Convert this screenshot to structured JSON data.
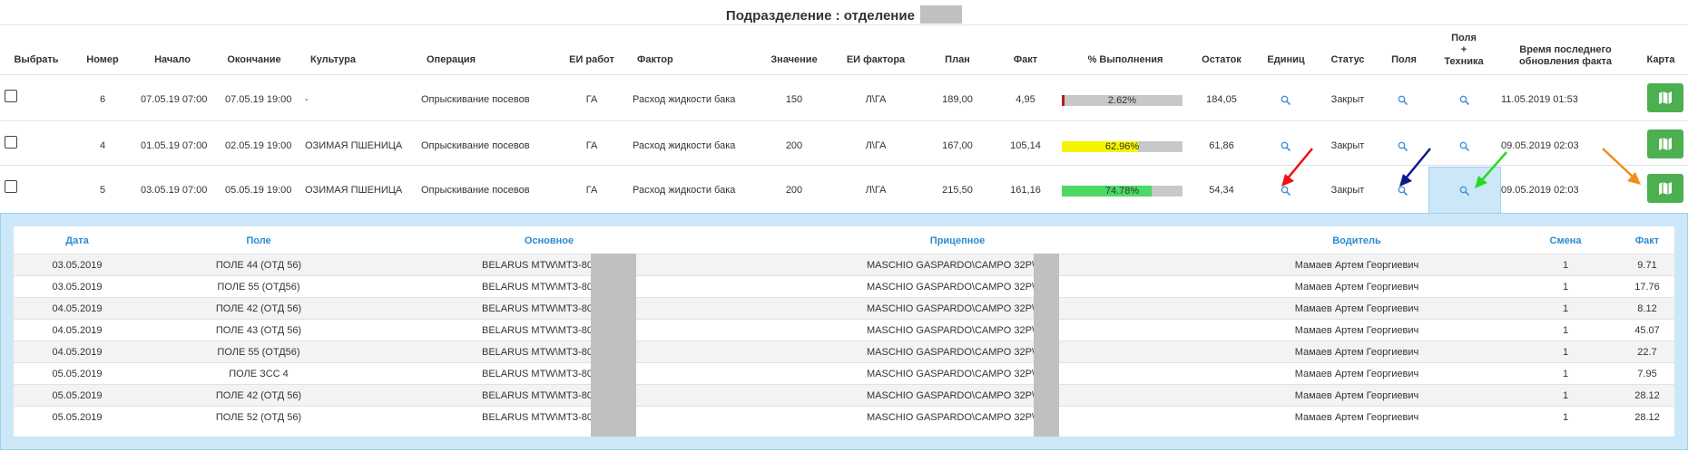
{
  "title": "Подразделение : отделение",
  "columns": {
    "select": "Выбрать",
    "number": "Номер",
    "start": "Начало",
    "end": "Окончание",
    "culture": "Культура",
    "operation": "Операция",
    "work_unit": "ЕИ работ",
    "factor": "Фактор",
    "value": "Значение",
    "factor_unit": "ЕИ фактора",
    "plan": "План",
    "fact": "Факт",
    "percent": "% Выполнения",
    "remain": "Остаток",
    "units": "Единиц",
    "status": "Статус",
    "fields": "Поля",
    "fields_tech_1": "Поля",
    "fields_tech_2": "+",
    "fields_tech_3": "Техника",
    "last_update_1": "Время последнего",
    "last_update_2": "обновления факта",
    "map": "Карта"
  },
  "rows": [
    {
      "number": "6",
      "start": "07.05.19 07:00",
      "end": "07.05.19 19:00",
      "culture": "-",
      "operation": "Опрыскивание посевов",
      "work_unit": "ГА",
      "factor": "Расход жидкости бака",
      "value": "150",
      "factor_unit": "Л\\ГА",
      "plan": "189,00",
      "fact": "4,95",
      "percent_label": "2.62%",
      "percent": 2.62,
      "bar_color": "#b71c1c",
      "remain": "184,05",
      "status": "Закрыт",
      "last_update": "11.05.2019 01:53"
    },
    {
      "number": "4",
      "start": "01.05.19 07:00",
      "end": "02.05.19 19:00",
      "culture": "ОЗИМАЯ ПШЕНИЦА",
      "operation": "Опрыскивание посевов",
      "work_unit": "ГА",
      "factor": "Расход жидкости бака",
      "value": "200",
      "factor_unit": "Л\\ГА",
      "plan": "167,00",
      "fact": "105,14",
      "percent_label": "62.96%",
      "percent": 62.96,
      "bar_color": "#f5f500",
      "remain": "61,86",
      "status": "Закрыт",
      "last_update": "09.05.2019 02:03"
    },
    {
      "number": "5",
      "start": "03.05.19 07:00",
      "end": "05.05.19 19:00",
      "culture": "ОЗИМАЯ ПШЕНИЦА",
      "operation": "Опрыскивание посевов",
      "work_unit": "ГА",
      "factor": "Расход жидкости бака",
      "value": "200",
      "factor_unit": "Л\\ГА",
      "plan": "215,50",
      "fact": "161,16",
      "percent_label": "74.78%",
      "percent": 74.78,
      "bar_color": "#4cd964",
      "remain": "54,34",
      "status": "Закрыт",
      "last_update": "09.05.2019 02:03"
    }
  ],
  "sub_columns": {
    "date": "Дата",
    "field": "Поле",
    "main": "Основное",
    "trailer": "Прицепное",
    "driver": "Водитель",
    "shift": "Смена",
    "fact": "Факт"
  },
  "sub_rows": [
    {
      "date": "03.05.2019",
      "field": "ПОЛЕ 44 (ОТД 56)",
      "main": "BELARUS MTW\\МТЗ-80\\91",
      "trailer": "MASCHIO GASPARDO\\CAMPO 32P\\",
      "driver": "Мамаев Артем Георгиевич",
      "shift": "1",
      "fact": "9.71"
    },
    {
      "date": "03.05.2019",
      "field": "ПОЛЕ 55 (ОТД56)",
      "main": "BELARUS MTW\\МТЗ-80\\91",
      "trailer": "MASCHIO GASPARDO\\CAMPO 32P\\",
      "driver": "Мамаев Артем Георгиевич",
      "shift": "1",
      "fact": "17.76"
    },
    {
      "date": "04.05.2019",
      "field": "ПОЛЕ 42 (ОТД 56)",
      "main": "BELARUS MTW\\МТЗ-80\\91",
      "trailer": "MASCHIO GASPARDO\\CAMPO 32P\\",
      "driver": "Мамаев Артем Георгиевич",
      "shift": "1",
      "fact": "8.12"
    },
    {
      "date": "04.05.2019",
      "field": "ПОЛЕ 43 (ОТД 56)",
      "main": "BELARUS MTW\\МТЗ-80\\91",
      "trailer": "MASCHIO GASPARDO\\CAMPO 32P\\",
      "driver": "Мамаев Артем Георгиевич",
      "shift": "1",
      "fact": "45.07"
    },
    {
      "date": "04.05.2019",
      "field": "ПОЛЕ 55 (ОТД56)",
      "main": "BELARUS MTW\\МТЗ-80\\91",
      "trailer": "MASCHIO GASPARDO\\CAMPO 32P\\",
      "driver": "Мамаев Артем Георгиевич",
      "shift": "1",
      "fact": "22.7"
    },
    {
      "date": "05.05.2019",
      "field": "ПОЛЕ ЗСС 4",
      "main": "BELARUS MTW\\МТЗ-80\\91",
      "trailer": "MASCHIO GASPARDO\\CAMPO 32P\\",
      "driver": "Мамаев Артем Георгиевич",
      "shift": "1",
      "fact": "7.95"
    },
    {
      "date": "05.05.2019",
      "field": "ПОЛЕ 42 (ОТД 56)",
      "main": "BELARUS MTW\\МТЗ-80\\91",
      "trailer": "MASCHIO GASPARDO\\CAMPO 32P\\",
      "driver": "Мамаев Артем Георгиевич",
      "shift": "1",
      "fact": "28.12"
    },
    {
      "date": "05.05.2019",
      "field": "ПОЛЕ 52 (ОТД 56)",
      "main": "BELARUS MTW\\МТЗ-80\\91",
      "trailer": "MASCHIO GASPARDO\\CAMPO 32P\\",
      "driver": "Мамаев Артем Георгиевич",
      "shift": "1",
      "fact": "28.12"
    }
  ],
  "icons": {
    "units": "search-icon",
    "fields": "search-icon",
    "fields_tech": "search-icon",
    "map": "map-icon"
  },
  "colors": {
    "map_button": "#4caf50",
    "link_blue": "#2a8cd0",
    "panel_bg": "#cce8f8"
  }
}
